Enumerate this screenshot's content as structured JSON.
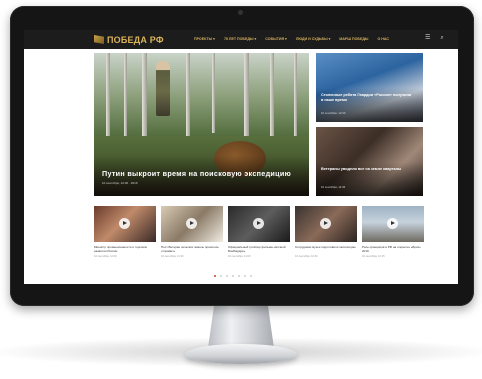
{
  "site": {
    "logo_text": "ПОБЕДА РФ",
    "brand_color": "#d6b15e",
    "nav_background": "#1c1c1c"
  },
  "nav": {
    "items": [
      {
        "label": "ПРОЕКТЫ ▾"
      },
      {
        "label": "75 ЛЕТ ПОБЕДЫ ▾"
      },
      {
        "label": "СОБЫТИЯ ▾"
      },
      {
        "label": "ЛЮДИ И СУДЬБЫ ▾"
      },
      {
        "label": "МАРШ ПОБЕДЫ"
      },
      {
        "label": "О НАС"
      }
    ],
    "icons": [
      "menu-icon",
      "search-icon"
    ]
  },
  "hero": {
    "title": "Путин выкроит время на поисковую экспедицию",
    "meta": "10 сентября, 12:00 · 2019"
  },
  "side_articles": [
    {
      "title": "Столичные ребята Гвардии «Россия» получили в наше время",
      "meta": "10 сентября, 12:00"
    },
    {
      "title": "Ветераны увидели все на земле кварталы",
      "meta": "10 сентября, 11:45"
    }
  ],
  "cards": [
    {
      "title": "Министр промышленности и торговли развития России",
      "meta": "10 сентября, 12:00"
    },
    {
      "title": "Пост Ветеран сельских земель пришлось отправить",
      "meta": "10 сентября, 11:30"
    },
    {
      "title": "Официальный трейлер фильма «Ночной Бомбардир»",
      "meta": "10 сентября, 11:00"
    },
    {
      "title": "Сотрудники музея подготовили экспозицию",
      "meta": "10 сентября, 10:40"
    },
    {
      "title": "Роль принципов в РФ на открытие «Бриз» 2019",
      "meta": "10 сентября, 10:15"
    }
  ],
  "slider": {
    "dot_count": 7,
    "active_index": 0,
    "active_color": "#c43a2a"
  }
}
